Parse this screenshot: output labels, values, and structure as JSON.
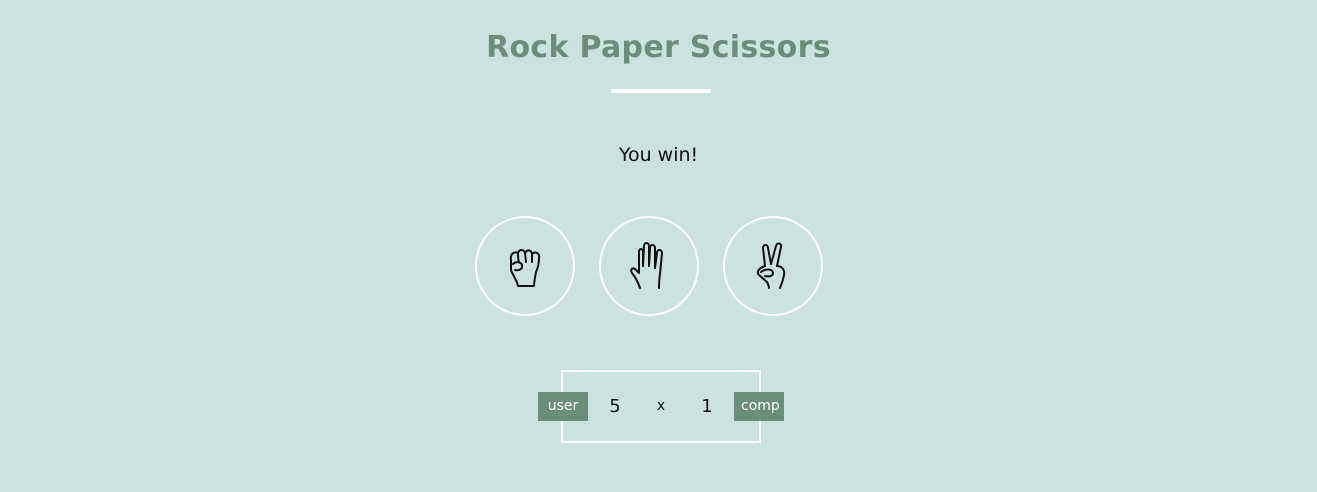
{
  "app": {
    "title": "Rock Paper Scissors"
  },
  "colors": {
    "background": "#cae3de",
    "accent": "#6b8e7b",
    "ring": "#ffffff"
  },
  "result": {
    "message": "You win!"
  },
  "choices": [
    {
      "id": "rock",
      "icon": "rock-hand-icon"
    },
    {
      "id": "paper",
      "icon": "paper-hand-icon"
    },
    {
      "id": "scissors",
      "icon": "scissors-hand-icon"
    }
  ],
  "scoreboard": {
    "user_label": "user",
    "user_score": "5",
    "separator": "x",
    "comp_score": "1",
    "comp_label": "comp"
  }
}
